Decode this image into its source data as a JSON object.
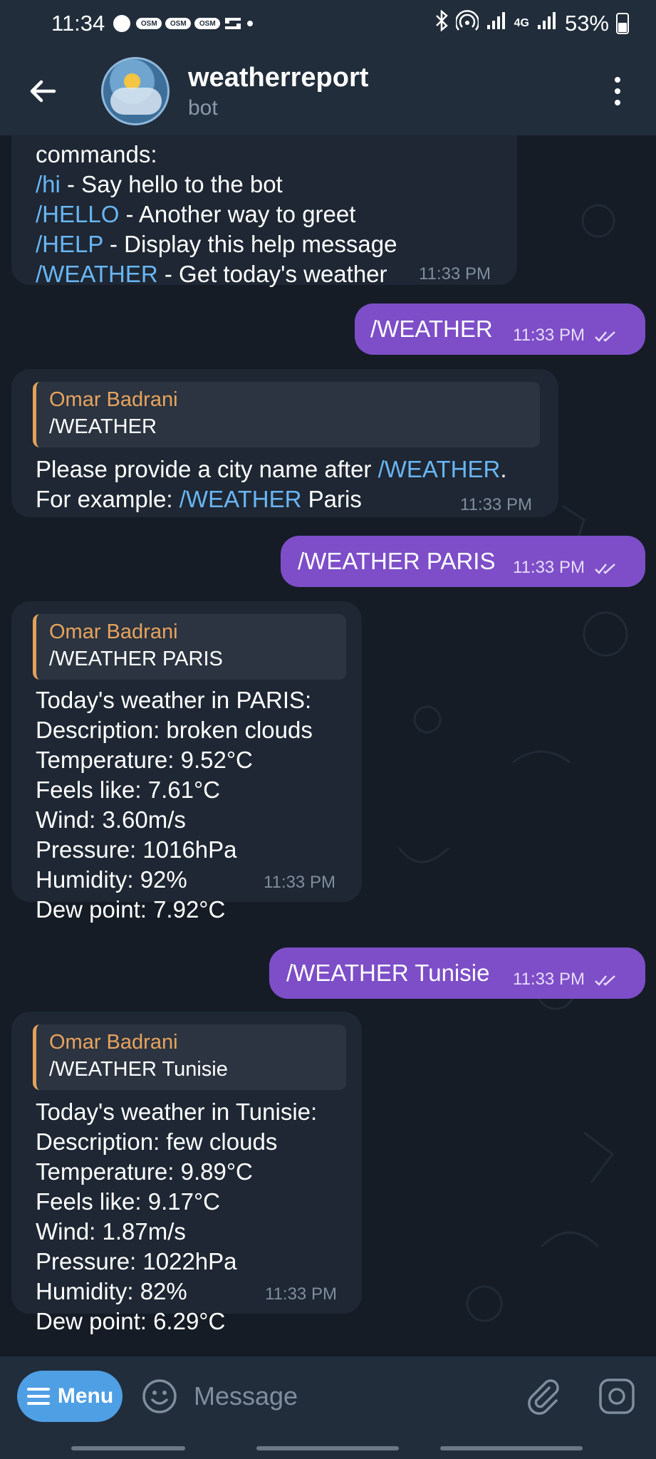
{
  "status_bar": {
    "time": "11:34",
    "osm_badge": "OSM",
    "network": "4G",
    "battery": "53%"
  },
  "header": {
    "title": "weatherreport",
    "subtitle": "bot"
  },
  "messages": {
    "m1": {
      "first_line": "commands:",
      "lines": [
        {
          "cmd": "/hi",
          "text": " - Say hello to the bot"
        },
        {
          "cmd": "/HELLO",
          "text": " - Another way to greet"
        },
        {
          "cmd": "/HELP",
          "text": " - Display this help message"
        },
        {
          "cmd": "/WEATHER",
          "text": " - Get today's weather"
        }
      ],
      "time": "11:33 PM"
    },
    "m2": {
      "text": "/WEATHER",
      "time": "11:33 PM"
    },
    "m3": {
      "reply_name": "Omar Badrani",
      "reply_text": "/WEATHER",
      "line1_a": "Please provide a city name after ",
      "line1_cmd": "/WEATHER",
      "line1_b": ".",
      "line2_a": "For example: ",
      "line2_cmd": "/WEATHER",
      "line2_b": " Paris",
      "time": "11:33 PM"
    },
    "m4": {
      "text": "/WEATHER PARIS",
      "time": "11:33 PM"
    },
    "m5": {
      "reply_name": "Omar Badrani",
      "reply_text": "/WEATHER PARIS",
      "lines": [
        "Today's weather in PARIS:",
        "Description: broken clouds",
        "Temperature: 9.52°C",
        "Feels like: 7.61°C",
        "Wind: 3.60m/s",
        "Pressure: 1016hPa",
        "Humidity: 92%",
        "Dew point: 7.92°C"
      ],
      "time": "11:33 PM"
    },
    "m6": {
      "text": "/WEATHER Tunisie",
      "time": "11:33 PM"
    },
    "m7": {
      "reply_name": "Omar Badrani",
      "reply_text": "/WEATHER Tunisie",
      "lines": [
        "Today's weather in Tunisie:",
        "Description: few clouds",
        "Temperature: 9.89°C",
        "Feels like: 9.17°C",
        "Wind: 1.87m/s",
        "Pressure: 1022hPa",
        "Humidity: 82%",
        "Dew point: 6.29°C"
      ],
      "time": "11:33 PM"
    }
  },
  "input_bar": {
    "menu_label": "Menu",
    "placeholder": "Message"
  },
  "colors": {
    "background": "#151c26",
    "bar": "#212d3b",
    "incoming_bubble": "#1e2733",
    "outgoing_bubble": "#7d4ec8",
    "link": "#69b6f5",
    "reply_name": "#e8a35e",
    "menu_button": "#4f9fe4"
  }
}
